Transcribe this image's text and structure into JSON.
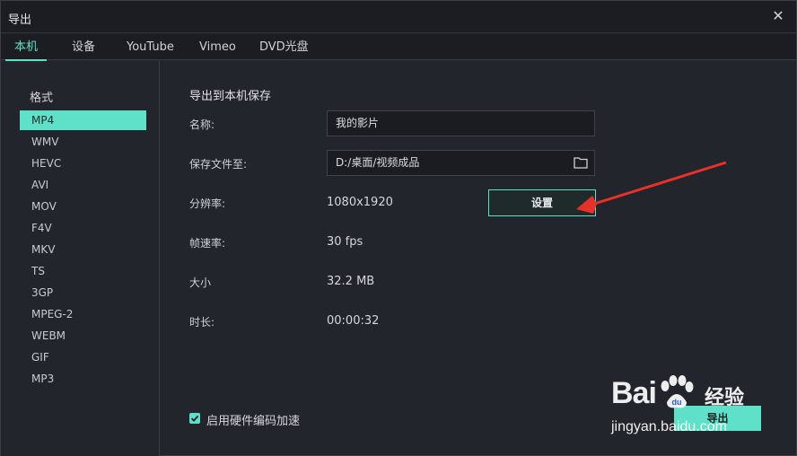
{
  "window": {
    "title": "导出",
    "close_glyph": "✕"
  },
  "tabs": [
    {
      "label": "本机",
      "active": true
    },
    {
      "label": "设备",
      "active": false
    },
    {
      "label": "YouTube",
      "active": false
    },
    {
      "label": "Vimeo",
      "active": false
    },
    {
      "label": "DVD光盘",
      "active": false
    }
  ],
  "sidebar": {
    "title": "格式",
    "formats": [
      "MP4",
      "WMV",
      "HEVC",
      "AVI",
      "MOV",
      "F4V",
      "MKV",
      "TS",
      "3GP",
      "MPEG-2",
      "WEBM",
      "GIF",
      "MP3"
    ],
    "selected": "MP4"
  },
  "main": {
    "section_title": "导出到本机保存",
    "name_label": "名称:",
    "name_value": "我的影片",
    "save_label": "保存文件至:",
    "save_path": "D:/桌面/视频成品",
    "resolution_label": "分辨率:",
    "resolution_value": "1080x1920",
    "settings_button": "设置",
    "framerate_label": "帧速率:",
    "framerate_value": "30 fps",
    "size_label": "大小",
    "size_value": "32.2 MB",
    "duration_label": "时长:",
    "duration_value": "00:00:32",
    "hw_accel_label": "启用硬件编码加速",
    "hw_accel_checked": true,
    "export_button": "导出"
  },
  "watermark": {
    "brand": "Bai",
    "cn": "经验",
    "url": "jingyan.baidu.com"
  },
  "colors": {
    "accent": "#5fe0c8",
    "annotation_arrow": "#e8312a",
    "background": "#22252b"
  },
  "icons": {
    "folder": "folder-icon",
    "close": "close-icon",
    "check": "check-icon"
  }
}
